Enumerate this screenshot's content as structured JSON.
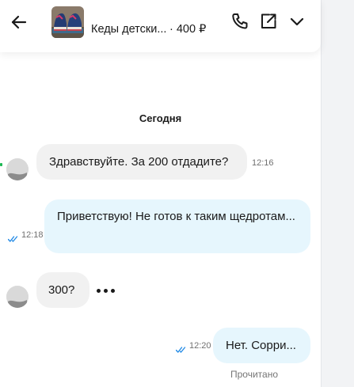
{
  "header": {
    "item_title": "Кеды детски...",
    "item_price": "· 400 ₽",
    "icons": [
      "back-arrow-icon",
      "product-thumbnail",
      "phone-icon",
      "open-external-icon",
      "chevron-down-icon"
    ]
  },
  "chat": {
    "date_separator": "Сегодня",
    "messages": [
      {
        "direction": "in",
        "text": "Здравствуйте. За 200 отдадите?",
        "time": "12:16"
      },
      {
        "direction": "out",
        "text": "Приветствую! Не готов к таким щедротам...",
        "time": "12:18"
      },
      {
        "direction": "in",
        "text": "300?",
        "time": ""
      },
      {
        "direction": "out",
        "text": "Нет. Сорри...",
        "time": "12:20"
      }
    ],
    "read_status": "Прочитано"
  },
  "colors": {
    "incoming_bubble": "#f1f1f1",
    "outgoing_bubble": "#e6f6fd",
    "read_tick": "#1e88e5",
    "online_indicator": "#1db954"
  }
}
